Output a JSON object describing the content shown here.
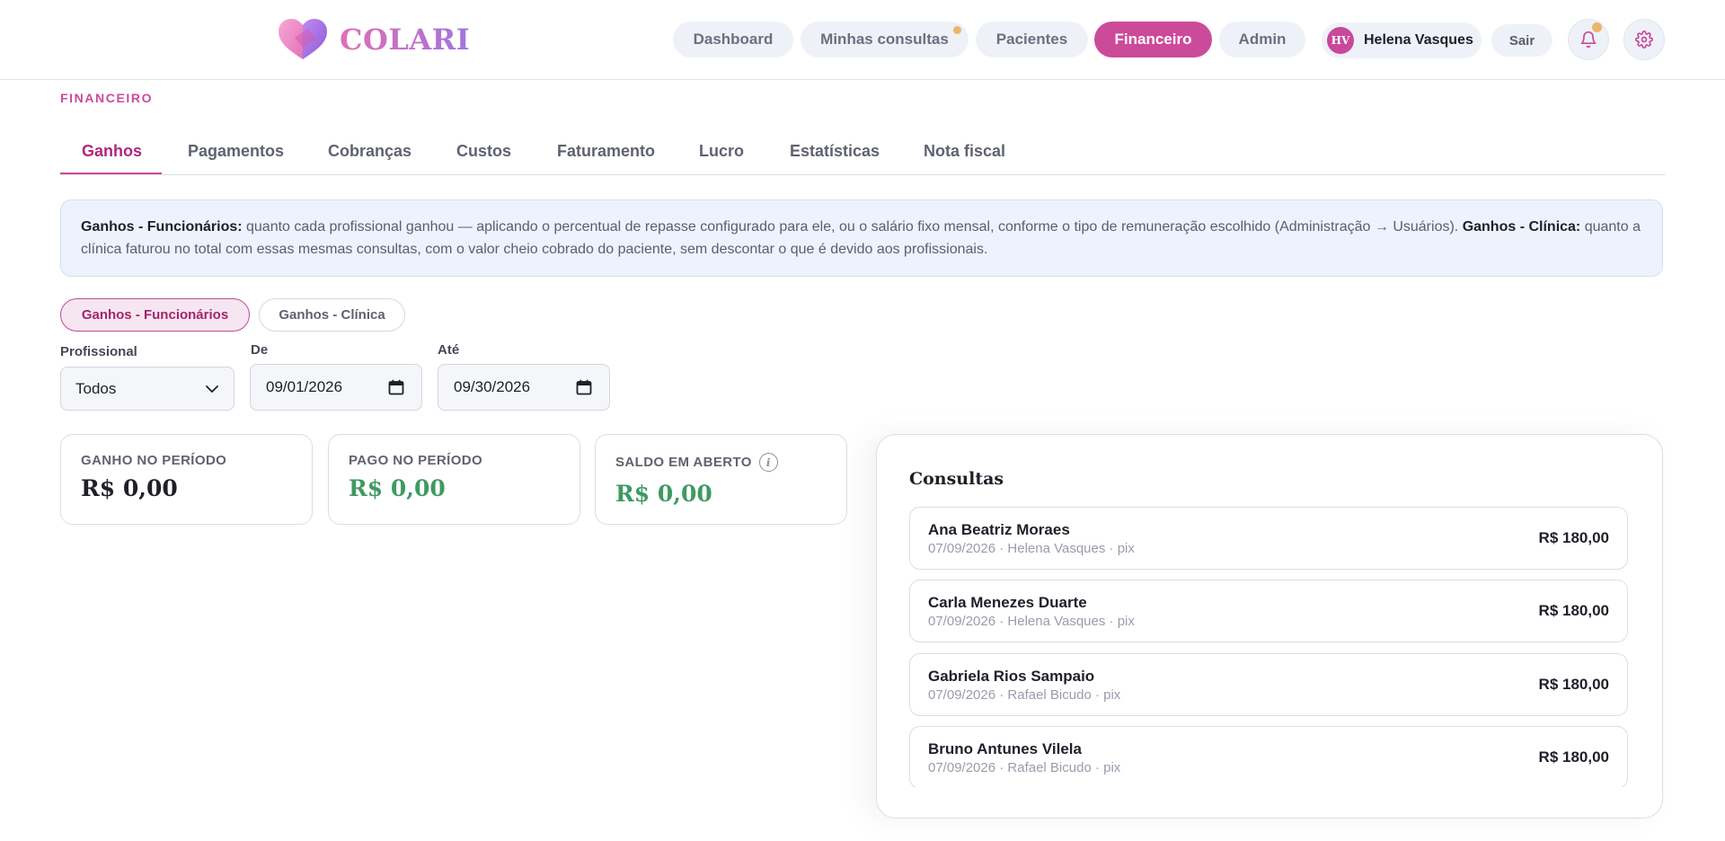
{
  "brand": {
    "name": "COLARI",
    "gradient": [
      "#f39ad0",
      "#9b6fe2"
    ]
  },
  "nav": {
    "items": [
      {
        "label": "Dashboard"
      },
      {
        "label": "Minhas consultas"
      },
      {
        "label": "Pacientes"
      },
      {
        "label": "Financeiro"
      },
      {
        "label": "Admin"
      }
    ],
    "active": "Financeiro"
  },
  "user": {
    "initials": "HV",
    "name": "Helena Vasques",
    "logout_label": "Sair"
  },
  "icons": {
    "notifications": "bell-icon",
    "settings": "gear-icon"
  },
  "section_label": "FINANCEIRO",
  "tabs": [
    "Ganhos",
    "Pagamentos",
    "Cobranças",
    "Custos",
    "Faturamento",
    "Lucro",
    "Estatísticas",
    "Nota fiscal"
  ],
  "info": {
    "b1": "Ganhos - Funcionários:",
    "t1": " quanto cada profissional ganhou — aplicando o percentual de repasse configurado para ele, ou o salário fixo mensal, conforme o tipo de remuneração escolhido (Administração → Usuários). ",
    "b2": "Ganhos - Clínica:",
    "t2": " quanto a clínica faturou no total com essas mesmas consultas, com o valor cheio cobrado do paciente, sem descontar o que é devido aos profissionais."
  },
  "toggle": {
    "funcionarios": "Ganhos - Funcionários",
    "clinica": "Ganhos - Clínica"
  },
  "filters": {
    "profissional_label": "Profissional",
    "profissional_value": "Todos",
    "de_label": "De",
    "de_value": "09/01/2026",
    "ate_label": "Até",
    "ate_value": "09/30/2026"
  },
  "stats": {
    "ganho_label": "GANHO NO PERÍODO",
    "ganho_value": "R$ 0,00",
    "pago_label": "PAGO NO PERÍODO",
    "pago_value": "R$ 0,00",
    "saldo_label": "SALDO EM ABERTO",
    "saldo_value": "R$ 0,00"
  },
  "consultas": {
    "title": "Consultas",
    "rows": [
      {
        "name": "Ana Beatriz Moraes",
        "meta": "07/09/2026 · Helena Vasques · pix",
        "value": "R$ 180,00"
      },
      {
        "name": "Carla Menezes Duarte",
        "meta": "07/09/2026 · Helena Vasques · pix",
        "value": "R$ 180,00"
      },
      {
        "name": "Gabriela Rios Sampaio",
        "meta": "07/09/2026 · Rafael Bicudo · pix",
        "value": "R$ 180,00"
      },
      {
        "name": "Bruno Antunes Vilela",
        "meta": "07/09/2026 · Rafael Bicudo · pix",
        "value": "R$ 180,00"
      }
    ]
  },
  "colors": {
    "accent": "#cc4a9a",
    "positive": "#3e9a61",
    "info_bg": "#edf2fc",
    "pill_bg": "#eef1f8"
  }
}
